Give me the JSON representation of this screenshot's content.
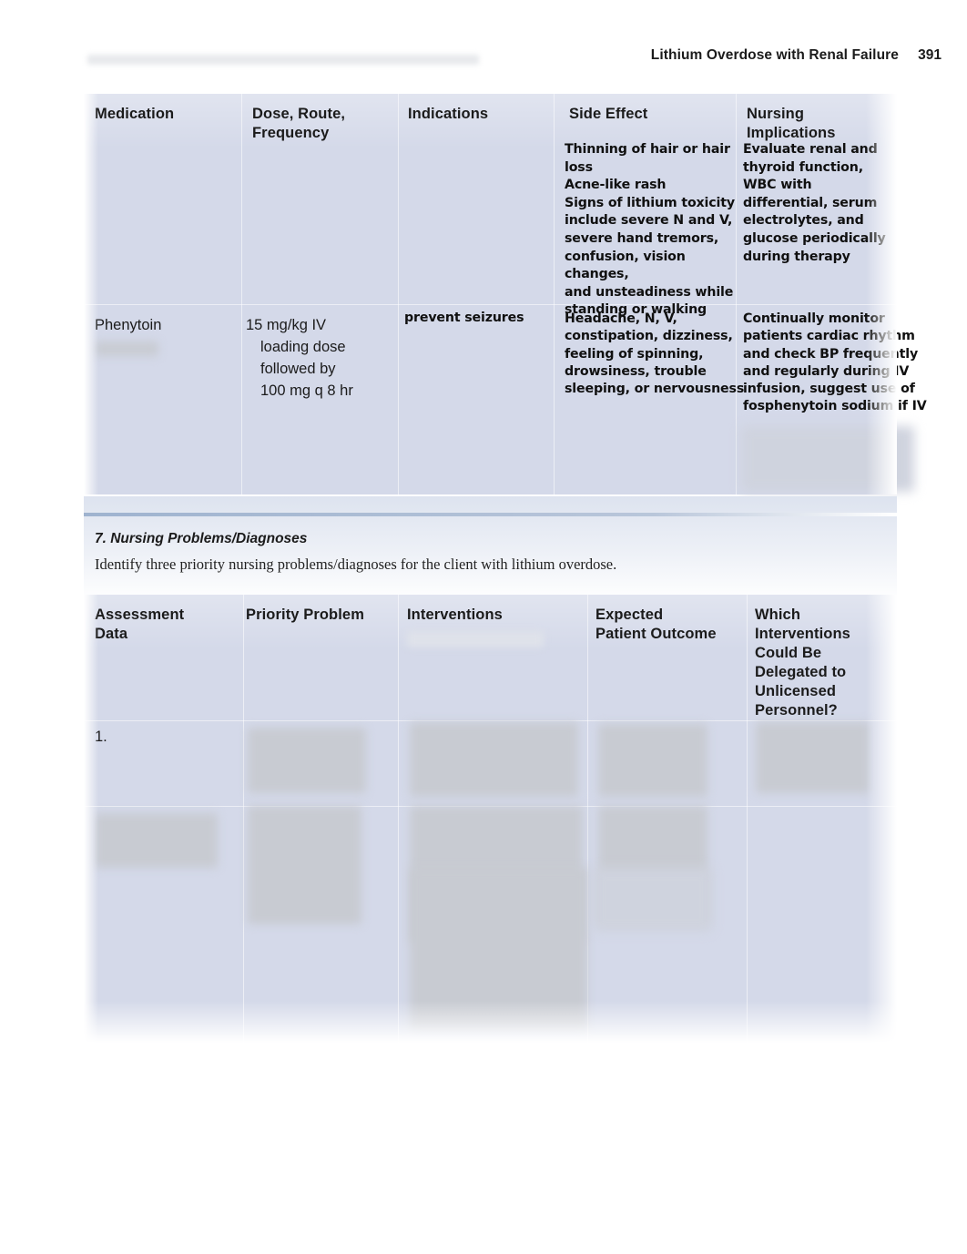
{
  "running_head": {
    "title": "Lithium Overdose with Renal Failure",
    "page_number": "391",
    "redacted_note": "redacted-text-bar"
  },
  "medication_table": {
    "headers": [
      "Medication",
      "Dose, Route,\nFrequency",
      "Indications",
      "Side Effect",
      "Nursing\nImplications"
    ],
    "header_lines": {
      "col1": "Medication",
      "col2_line1": "Dose, Route,",
      "col2_line2": "Frequency",
      "col3": "Indications",
      "col4": "Side Effect",
      "col5_line1": "Nursing",
      "col5_line2": "Implications"
    },
    "rows": [
      {
        "medication": "",
        "medication_redacted": true,
        "dose": "",
        "indications": "",
        "side_effect": "Thinning of hair or hair loss\nAcne-like rash\nSigns of lithium toxicity include severe N and V, severe hand tremors, confusion, vision changes, and unsteadiness while standing or walking",
        "side_effect_lines": [
          "Thinning of hair or hair",
          "loss",
          "Acne-like rash",
          "Signs of lithium toxicity",
          "include severe N and V,",
          "severe hand tremors,",
          "confusion, vision changes,",
          "and unsteadiness while",
          "standing or walking"
        ],
        "nursing_implications": "Evaluate renal and thyroid function, WBC with differential, serum electrolytes, and glucose periodically during therapy",
        "nursing_implications_lines": [
          "Evaluate renal and",
          "thyroid function,",
          "WBC with",
          "differential, serum",
          "electrolytes, and",
          "glucose periodically",
          "during therapy"
        ]
      },
      {
        "medication": "Phenytoin",
        "medication_redacted": true,
        "dose_lines": [
          "15 mg/kg IV",
          "loading dose",
          "followed by",
          "100 mg q 8 hr"
        ],
        "indications": "prevent seizures",
        "side_effect": "Headache, N, V, constipation, dizziness, feeling of spinning, drowsiness, trouble sleeping, or nervousness",
        "side_effect_lines": [
          "Headache, N, V,",
          "constipation, dizziness,",
          "feeling of spinning,",
          "drowsiness, trouble",
          "sleeping, or nervousness"
        ],
        "nursing_implications": "Continually monitor patients cardiac rhythm and check BP frequently and regularly during IV infusion, suggest use of fosphenytoin sodium if IV",
        "nursing_implications_lines": [
          "Continually monitor",
          "patients cardiac rhythm",
          "and check BP frequently",
          "and regularly during IV",
          "infusion, suggest use of",
          "fosphenytoin sodium if IV"
        ],
        "nursing_implications_redacted": true
      }
    ]
  },
  "section7": {
    "heading": "7. Nursing Problems/Diagnoses",
    "instruction": "Identify three priority nursing problems/diagnoses for the client with lithium overdose."
  },
  "problems_table": {
    "headers": [
      "Assessment\nData",
      "Priority Problem",
      "Interventions",
      "Expected\nPatient Outcome",
      "Which\nInterventions\nCould Be\nDelegated to\nUnlicensed\nPersonnel?"
    ],
    "header_lines": {
      "col1_line1": "Assessment",
      "col1_line2": "Data",
      "col2": "Priority Problem",
      "col3": "Interventions",
      "col3_redacted": true,
      "col4_line1": "Expected",
      "col4_line2": "Patient Outcome",
      "col5_line1": "Which",
      "col5_line2": "Interventions",
      "col5_line3": "Could Be",
      "col5_line4": "Delegated to",
      "col5_line5": "Unlicensed",
      "col5_line6": "Personnel?"
    },
    "rows": [
      {
        "number": "1.",
        "assessment_data": "",
        "priority_problem": "",
        "interventions": "",
        "expected_outcome": "",
        "delegation": "",
        "content_redacted": true
      }
    ]
  },
  "colors": {
    "table_background": "#d4d9e9",
    "page_background": "#ffffff",
    "text": "#1b1b1b",
    "rule": "#9fb3cf",
    "redaction": "#c8cbd2"
  }
}
